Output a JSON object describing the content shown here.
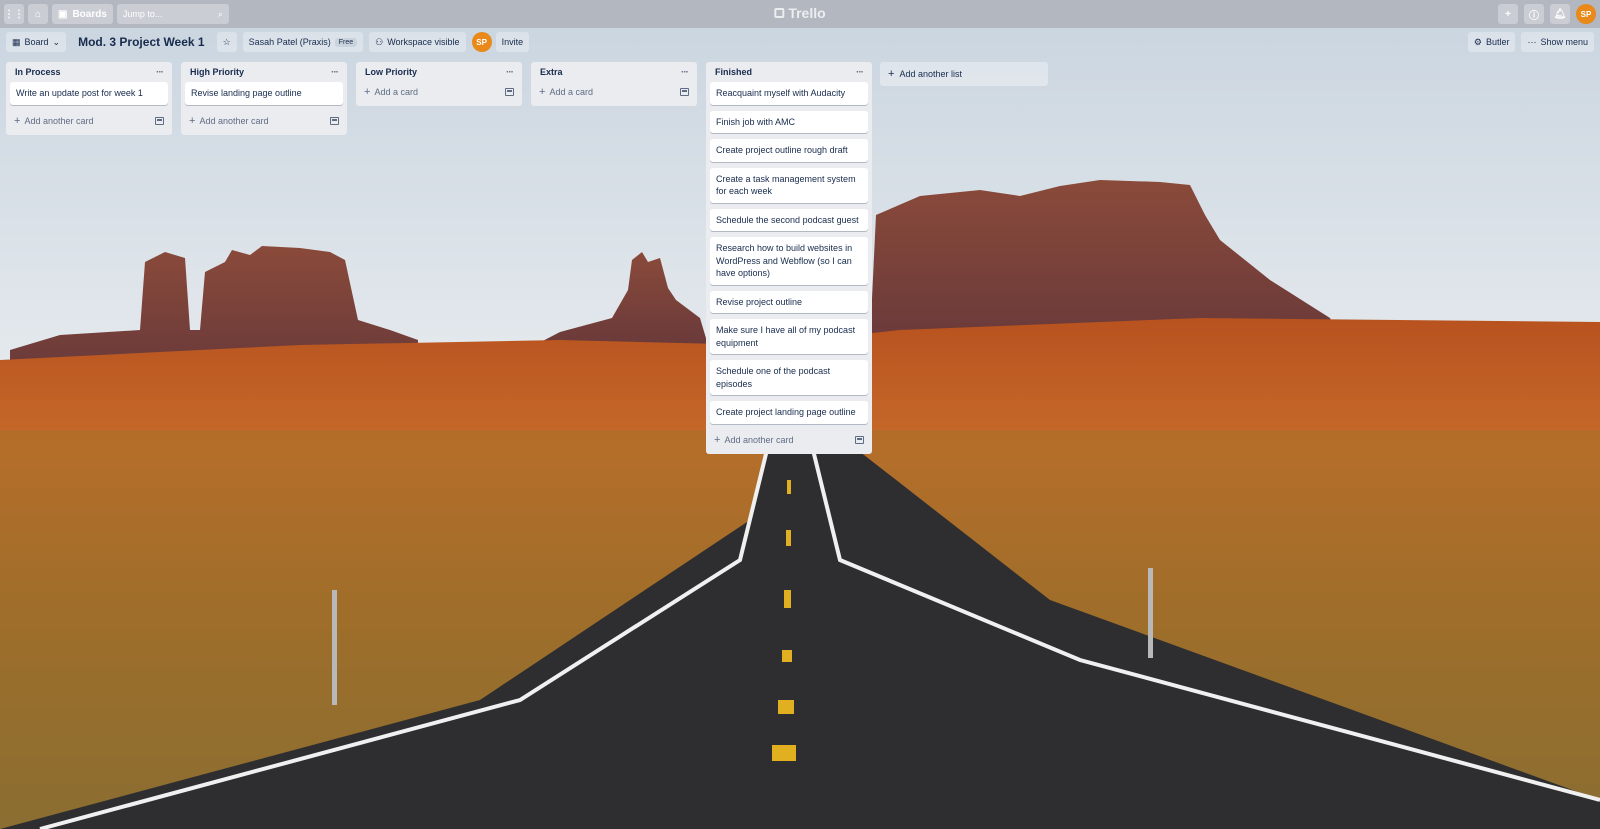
{
  "topnav": {
    "boards_label": "Boards",
    "search_placeholder": "Jump to...",
    "logo_text": "Trello",
    "avatar_initials": "SP"
  },
  "header": {
    "view_label": "Board",
    "board_title": "Mod. 3 Project Week 1",
    "workspace_name": "Sasah Patel (Praxis)",
    "workspace_plan": "Free",
    "visibility_label": "Workspace visible",
    "member_initials": "SP",
    "invite_label": "Invite",
    "butler_label": "Butler",
    "show_menu_label": "Show menu"
  },
  "lists": [
    {
      "title": "In Process",
      "cards": [
        "Write an update post for week 1"
      ],
      "add_label": "Add another card"
    },
    {
      "title": "High Priority",
      "cards": [
        "Revise landing page outline"
      ],
      "add_label": "Add another card"
    },
    {
      "title": "Low Priority",
      "cards": [],
      "add_label": "Add a card"
    },
    {
      "title": "Extra",
      "cards": [],
      "add_label": "Add a card"
    },
    {
      "title": "Finished",
      "cards": [
        "Reacquaint myself with Audacity",
        "Finish job with AMC",
        "Create project outline rough draft",
        "Create a task management system for each week",
        "Schedule the second podcast guest",
        "Research how to build websites in WordPress and Webflow (so I can have options)",
        "Revise project outline",
        "Make sure I have all of my podcast equipment",
        "Schedule one of the podcast episodes",
        "Create project landing page outline"
      ],
      "add_label": "Add another card"
    }
  ],
  "add_list_label": "Add another list",
  "colors": {
    "accent": "#e8891a",
    "list_bg": "#ebecf0"
  }
}
